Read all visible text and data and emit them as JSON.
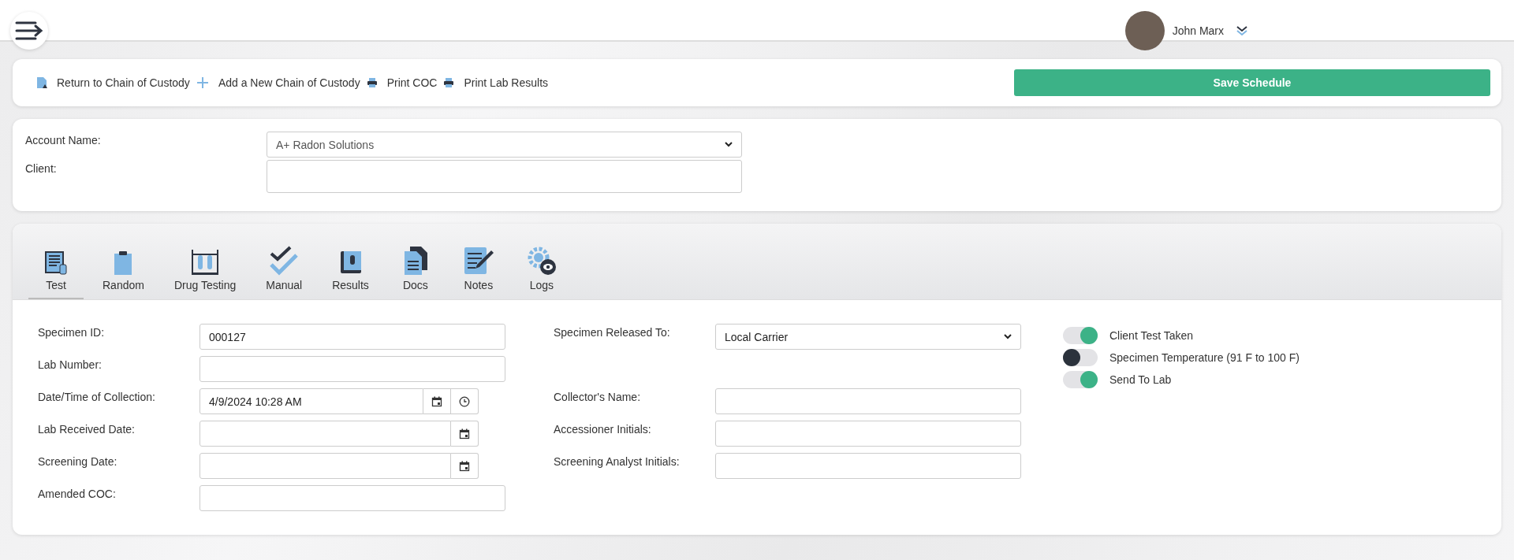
{
  "header": {
    "user_name": "John Marx"
  },
  "toolbar": {
    "actions": [
      {
        "label": "Return to Chain of Custody",
        "kind": "doc"
      },
      {
        "label": "Add a New Chain of Custody",
        "kind": "add"
      },
      {
        "label": "Print COC",
        "kind": "print"
      },
      {
        "label": "Print Lab Results",
        "kind": "print"
      }
    ],
    "save_button": "Save Schedule"
  },
  "account": {
    "fields": [
      {
        "label": "Account Name:",
        "kind": "select",
        "value": "A+ Radon Solutions"
      },
      {
        "label": "Client:",
        "kind": "text"
      }
    ]
  },
  "tabs": [
    {
      "label": "Test",
      "kind": "test",
      "selected": true
    },
    {
      "label": "Random",
      "kind": "clipboard",
      "selected": false
    },
    {
      "label": "Drug Testing",
      "kind": "tubes",
      "selected": false
    },
    {
      "label": "Manual",
      "kind": "checks",
      "selected": false
    },
    {
      "label": "Results",
      "kind": "book",
      "selected": false
    },
    {
      "label": "Docs",
      "kind": "docs",
      "selected": false
    },
    {
      "label": "Notes",
      "kind": "notes",
      "selected": false
    },
    {
      "label": "Logs",
      "kind": "logs",
      "selected": false
    }
  ],
  "form_rows": [
    {
      "left": {
        "label": "Specimen ID:",
        "kind": "text",
        "value": "000127"
      },
      "right": {
        "label": "Specimen Released To:",
        "kind": "select",
        "value": "Local Carrier"
      }
    },
    {
      "left": {
        "label": "Lab Number:",
        "kind": "text"
      }
    },
    {
      "left": {
        "label": "Date/Time of Collection:",
        "kind": "datetime",
        "value": "4/9/2024 10:28 AM"
      },
      "right": {
        "label": "Collector's Name:",
        "kind": "text"
      }
    },
    {
      "left": {
        "label": "Lab Received Date:",
        "kind": "date"
      },
      "right": {
        "label": "Accessioner Initials:",
        "kind": "text"
      }
    },
    {
      "left": {
        "label": "Screening Date:",
        "kind": "date"
      },
      "right": {
        "label": "Screening Analyst Initials:",
        "kind": "text"
      }
    },
    {
      "left": {
        "label": "Amended COC:",
        "kind": "text"
      }
    }
  ],
  "toggles": [
    {
      "label": "Client Test Taken",
      "on": true
    },
    {
      "label": "Specimen Temperature (91 F to 100 F)",
      "on": false
    },
    {
      "label": "Send To Lab",
      "on": true
    }
  ]
}
